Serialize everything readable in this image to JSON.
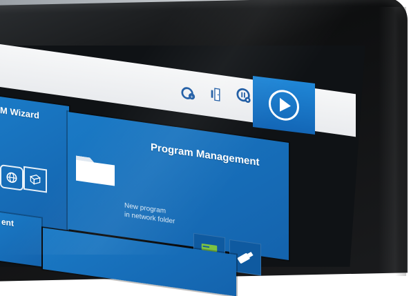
{
  "tiles": {
    "wizard": {
      "title": "M Wizard"
    },
    "program": {
      "title": "Program Management",
      "subtitle_line1": "New program",
      "subtitle_line2": "in network folder"
    },
    "bottom_left": {
      "title": "ent"
    }
  },
  "icons": {
    "topbar": [
      "network-status-icon",
      "door-exit-icon",
      "pause-settings-icon"
    ],
    "play": "play-icon",
    "program_folder": "folder-icon",
    "program_actions": [
      "network-drive-icon",
      "usb-stick-icon"
    ],
    "wizard_actions": [
      "globe-icon",
      "box-3d-icon"
    ]
  },
  "colors": {
    "tile_blue": "#1a7ac6",
    "play_blue": "#1f86d6",
    "icon_blue": "#1c5aa3",
    "network_green": "#7cc242",
    "topbar_bg": "#f1f2f4"
  }
}
